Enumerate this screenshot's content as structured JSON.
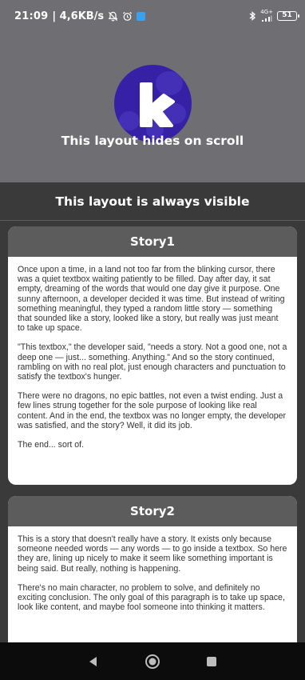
{
  "status_bar": {
    "time": "21:09",
    "network_speed": "| 4,6KB/s",
    "network_type": "4G+",
    "battery": "51"
  },
  "collapsing_header": {
    "title": "This layout hides on scroll",
    "logo_letter": "k"
  },
  "sticky_header": {
    "title": "This layout is always visible"
  },
  "stories": [
    {
      "title": "Story1",
      "paragraphs": [
        "Once upon a time, in a land not too far from the blinking cursor, there was a quiet textbox waiting patiently to be filled. Day after day, it sat empty, dreaming of the words that would one day give it purpose. One sunny afternoon, a developer decided it was time. But instead of writing something meaningful, they typed a random little story — something that sounded like a story, looked like a story, but really was just meant to take up space.",
        "\"This textbox,\" the developer said, \"needs a story. Not a good one, not a deep one — just... something. Anything.\" And so the story continued, rambling on with no real plot, just enough characters and punctuation to satisfy the textbox's hunger.",
        "There were no dragons, no epic battles, not even a twist ending. Just a few lines strung together for the sole purpose of looking like real content. And in the end, the textbox was no longer empty, the developer was satisfied, and the story? Well, it did its job.",
        "The end... sort of."
      ]
    },
    {
      "title": "Story2",
      "paragraphs": [
        "This is a story that doesn't really have a story. It exists only because someone needed words — any words — to go inside a textbox. So here they are, lining up nicely to make it seem like something important is being said. But really, nothing is happening.",
        "There's no main character, no problem to solve, and definitely no exciting conclusion. The only goal of this paragraph is to take up space, look like content, and maybe fool someone into thinking it matters."
      ]
    }
  ],
  "colors": {
    "header_bg": "#6f6e72",
    "page_bg": "#3a3a3a",
    "card_header_bg": "#5c5c5c",
    "logo_bg": "#3520a6"
  }
}
